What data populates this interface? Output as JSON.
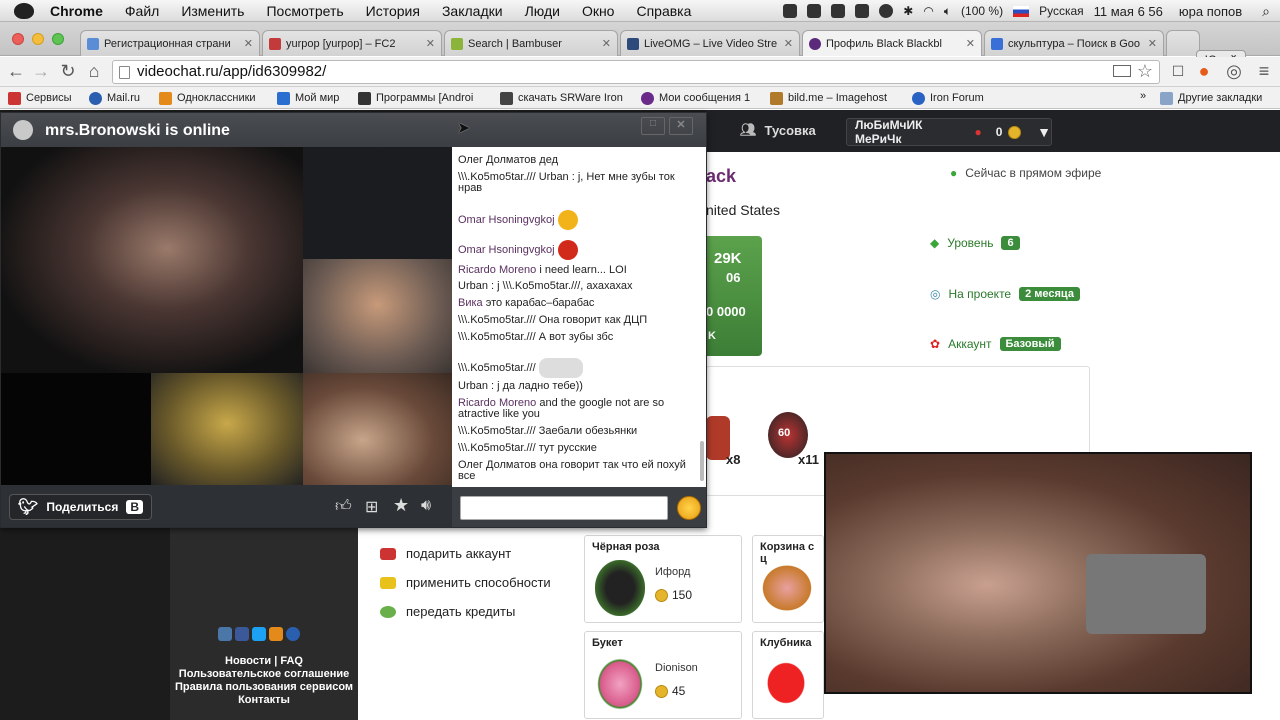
{
  "menubar": {
    "app": "Chrome",
    "items": [
      "Файл",
      "Изменить",
      "Посмотреть",
      "История",
      "Закладки",
      "Люди",
      "Окно",
      "Справка"
    ],
    "battery": "(100 %)",
    "input_source": "Русская",
    "datetime": "11 мая  6 56",
    "user": "юра попов"
  },
  "tabs": [
    {
      "title": "Регистрационная страни",
      "color": "#5a8dd6"
    },
    {
      "title": "yurpop [yurpop] – FC2",
      "color": "#c23a3a"
    },
    {
      "title": "Search | Bambuser",
      "color": "#8cb43a"
    },
    {
      "title": "LiveOMG – Live Video Stre",
      "color": "#2d4a7a"
    },
    {
      "title": "Профиль Black Blackbl",
      "color": "#5b2a7a"
    },
    {
      "title": "скульптура – Поиск в Goo",
      "color": "#3a6fd8"
    }
  ],
  "profile_button": "Юрий",
  "toolbar": {
    "url": "videochat.ru/app/id6309982/"
  },
  "bookmarks": [
    {
      "label": "Сервисы",
      "color": "#cc3333"
    },
    {
      "label": "Mail.ru",
      "color": "#2a5fb0"
    },
    {
      "label": "Одноклассники",
      "color": "#e48a1a"
    },
    {
      "label": "Мой мир",
      "color": "#2a6fd0"
    },
    {
      "label": "Программы [Androi",
      "color": "#333333"
    },
    {
      "label": "скачать SRWare Iron",
      "color": "#444444"
    },
    {
      "label": "Мои сообщения 1",
      "color": "#6a2a8a"
    },
    {
      "label": "bild.me – Imagehost",
      "color": "#b07a2a"
    },
    {
      "label": "Iron Forum",
      "color": "#2a62c4"
    }
  ],
  "bookmarks_other": "Другие закладки",
  "site": {
    "tusovka": "Тусовка",
    "username": "ЛюБиМчИК МеРиЧк",
    "coins": "0",
    "live_status": "Сейчас в прямом эфире",
    "profile_name_fragment": "ack",
    "country_fragment": "nited States",
    "level_label": "Уровень",
    "level_value": "6",
    "project_label": "На проекте",
    "project_value": "2 месяца",
    "account_label": "Аккаунт",
    "account_value": "Базовый",
    "counter_top": "29K",
    "counter_mid": "06",
    "counter_bottom": "0 0000",
    "counter_k": "K",
    "gift_x8": "x8",
    "gift_x11": "x11",
    "badge_60": "60",
    "actions": [
      "подарить аккаунт",
      "применить способности",
      "передать кредиты"
    ],
    "sidebar_links": [
      "Новости",
      "|",
      "FAQ",
      "Пользовательское соглашение",
      "Правила пользования сервисом",
      "Контакты"
    ],
    "gifts": [
      {
        "title": "Чёрная роза",
        "user": "Ифорд",
        "price": "150"
      },
      {
        "title": "Корзина с ц",
        "user": "",
        "price": ""
      },
      {
        "title": "Букет",
        "user": "Dionison",
        "price": "45"
      },
      {
        "title": "Клубника",
        "user": "",
        "price": ""
      }
    ]
  },
  "chat": {
    "title": "mrs.Bronowski is online",
    "share": "Поделиться",
    "messages": [
      {
        "name": "Олег Долматов",
        "text": "дед",
        "named": false
      },
      {
        "name": "\\\\\\.Ko5mo5tar.///",
        "text": "Urban : j, Нет мне зубы ток нрав",
        "named": false
      },
      {
        "name": "Omar Hsoningvgkoj",
        "text": "",
        "named": true,
        "emo": "#f2b21a"
      },
      {
        "name": "Omar Hsoningvgkoj",
        "text": "",
        "named": true,
        "emo": "#d22a1a"
      },
      {
        "name": "Ricardo Moreno",
        "text": "i need learn... LOI",
        "named": true
      },
      {
        "name": "Urban : j \\\\\\.Ko5mo5tar.///, ахахахах",
        "text": "",
        "named": false
      },
      {
        "name": "Вика",
        "text": "это карабас–барабас",
        "named": true
      },
      {
        "name": "\\\\\\.Ko5mo5tar.///",
        "text": "Она говорит как ДЦП",
        "named": false
      },
      {
        "name": "\\\\\\.Ko5mo5tar.///",
        "text": "А вот зубы збс",
        "named": false
      },
      {
        "name": "\\\\\\.Ko5mo5tar.///",
        "text": "",
        "named": false,
        "emo": "#dddddd"
      },
      {
        "name": "Urban : j да ладно тебе))",
        "text": "",
        "named": false
      },
      {
        "name": "Ricardo Moreno",
        "text": "and the google not are so atractive like you",
        "named": true
      },
      {
        "name": "\\\\\\.Ko5mo5tar.///",
        "text": "Заебали обезьянки",
        "named": false
      },
      {
        "name": "\\\\\\.Ko5mo5tar.///",
        "text": "тут русские",
        "named": false
      },
      {
        "name": "Олег Долматов",
        "text": "она говорит так что ей похуй все",
        "named": false
      }
    ]
  }
}
